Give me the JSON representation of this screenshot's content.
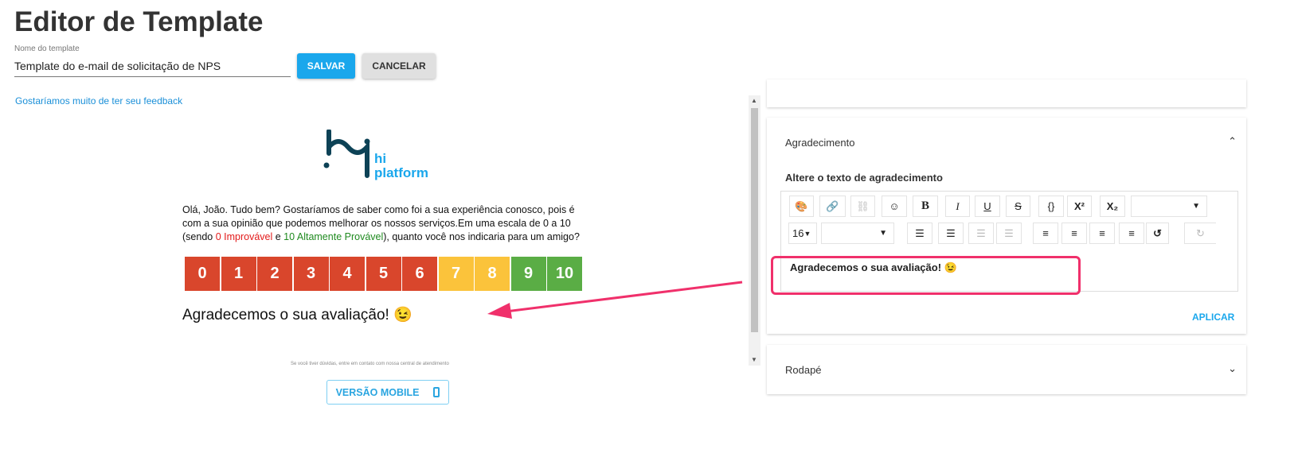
{
  "header": {
    "title": "Editor de Template",
    "name_label": "Nome do template",
    "name_value": "Template do e-mail de solicitação de NPS",
    "save_label": "SALVAR",
    "cancel_label": "CANCELAR"
  },
  "preview": {
    "feedback_link": "Gostaríamos muito de ter seu feedback",
    "logo_text_1": "hi",
    "logo_text_2": "platform",
    "body_1": "Olá, João. Tudo bem? Gostaríamos de saber como foi a sua experiência conosco, pois é com a sua opinião que podemos melhorar os nossos serviços.Em uma escala de 0 a 10 (sendo ",
    "body_low": "0 Improvável",
    "body_mid": " e ",
    "body_high": "10 Altamente Provável",
    "body_2": "), quanto você nos indicaria para um amigo?",
    "scores": [
      "0",
      "1",
      "2",
      "3",
      "4",
      "5",
      "6",
      "7",
      "8",
      "9",
      "10"
    ],
    "score_colors": {
      "detractor": "#d9462c",
      "passive": "#fbc33b",
      "promoter": "#5aad45"
    },
    "thanks": "Agradecemos o sua avaliação! 😉",
    "footer_note": "Se você tiver dúvidas, entre em contato com nossa central de atendimento",
    "mobile_label": "VERSÃO MOBILE"
  },
  "panel": {
    "agr_title": "Agradecimento",
    "agr_label": "Altere o texto de agradecimento",
    "font_size": "16",
    "content": "Agradecemos o sua avaliação! 😉",
    "apply_label": "APLICAR",
    "footer_title": "Rodapé"
  },
  "colors": {
    "accent": "#1aa7ec",
    "highlight": "#f0306b"
  }
}
